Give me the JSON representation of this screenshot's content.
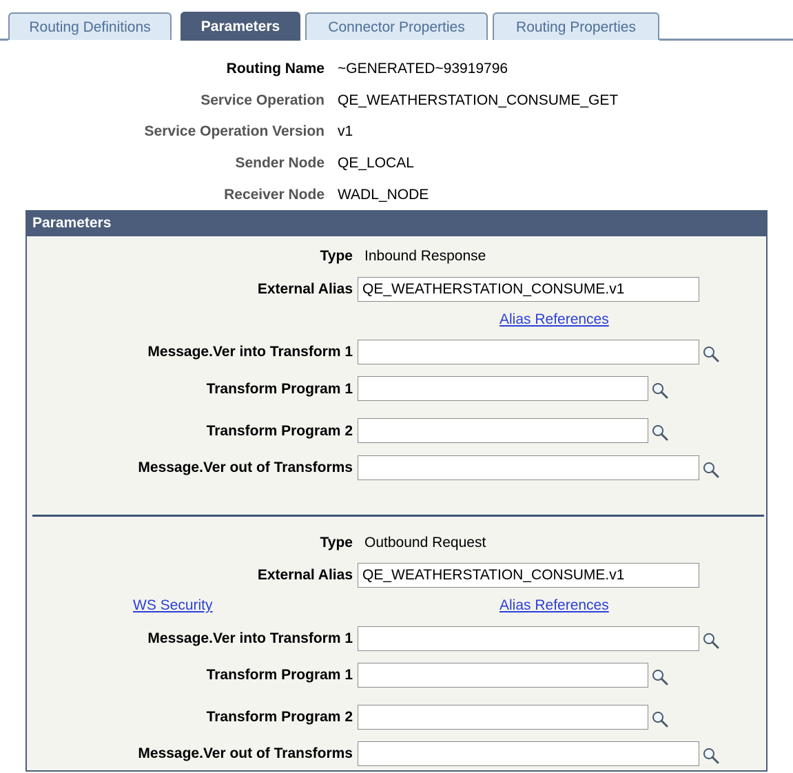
{
  "tabs": [
    {
      "label": "Routing Definitions",
      "active": false
    },
    {
      "label": "Parameters",
      "active": true
    },
    {
      "label": "Connector Properties",
      "active": false
    },
    {
      "label": "Routing Properties",
      "active": false
    }
  ],
  "header": {
    "routing_name_label": "Routing Name",
    "routing_name_value": "~GENERATED~93919796",
    "service_operation_label": "Service Operation",
    "service_operation_value": "QE_WEATHERSTATION_CONSUME_GET",
    "service_operation_version_label": "Service Operation Version",
    "service_operation_version_value": "v1",
    "sender_node_label": "Sender Node",
    "sender_node_value": "QE_LOCAL",
    "receiver_node_label": "Receiver Node",
    "receiver_node_value": "WADL_NODE"
  },
  "parameters": {
    "title": "Parameters",
    "inbound": {
      "type_label": "Type",
      "type_value": "Inbound Response",
      "external_alias_label": "External Alias",
      "external_alias_value": "QE_WEATHERSTATION_CONSUME.v1",
      "alias_references_link": "Alias References",
      "msg_into_transform_label": "Message.Ver into Transform 1",
      "msg_into_transform_value": "",
      "transform_program_1_label": "Transform Program 1",
      "transform_program_1_value": "",
      "transform_program_2_label": "Transform Program 2",
      "transform_program_2_value": "",
      "msg_out_transforms_label": "Message.Ver out of Transforms",
      "msg_out_transforms_value": ""
    },
    "outbound": {
      "type_label": "Type",
      "type_value": "Outbound Request",
      "external_alias_label": "External Alias",
      "external_alias_value": "QE_WEATHERSTATION_CONSUME.v1",
      "ws_security_link": "WS Security",
      "alias_references_link": "Alias References",
      "msg_into_transform_label": "Message.Ver into Transform 1",
      "msg_into_transform_value": "",
      "transform_program_1_label": "Transform Program 1",
      "transform_program_1_value": "",
      "transform_program_2_label": "Transform Program 2",
      "transform_program_2_value": "",
      "msg_out_transforms_label": "Message.Ver out of Transforms",
      "msg_out_transforms_value": ""
    }
  },
  "icons": {
    "lookup": "magnifier-lookup-icon"
  },
  "colors": {
    "accent": "#4b5d7a",
    "tab_inactive_bg": "#dce8f3",
    "link": "#2b3fd6",
    "panel_bg": "#f4f4ef"
  }
}
